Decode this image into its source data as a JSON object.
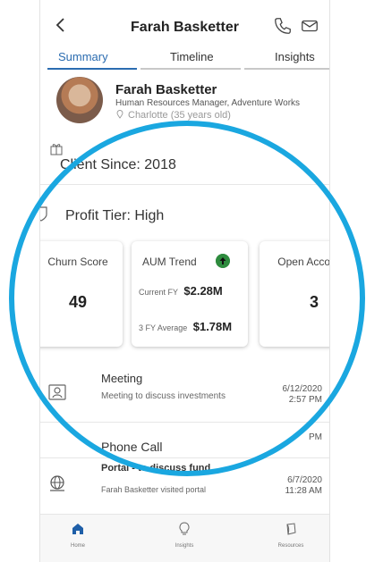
{
  "header": {
    "title": "Farah Basketter"
  },
  "tabs": [
    {
      "label": "Summary",
      "active": true
    },
    {
      "label": "Timeline"
    },
    {
      "label": "Insights"
    }
  ],
  "profile": {
    "name": "Farah Basketter",
    "role": "Human Resources Manager, Adventure Works",
    "details_partial": "Charlotte (35 years old)"
  },
  "summary": {
    "client_since": "Client Since: 2018",
    "profit_tier": "Profit Tier: High"
  },
  "cards": {
    "churn": {
      "title": "Churn Score",
      "value": "49"
    },
    "aum": {
      "title": "AUM Trend",
      "current_label": "Current FY",
      "current_value": "$2.28M",
      "avg_label": "3 FY Average",
      "avg_value": "$1.78M",
      "trend": "up",
      "trend_color": "#2e8b3e"
    },
    "accounts": {
      "title": "Open Accounts",
      "value": "3"
    }
  },
  "timeline": [
    {
      "title": "Meeting",
      "desc": "Meeting to discuss investments",
      "date": "6/12/2020",
      "time": "2:57 PM"
    },
    {
      "title": "Phone Call",
      "date_partial": "PM"
    },
    {
      "title": "Portal - to discuss fund",
      "desc": "Farah Basketter visited portal",
      "date": "6/7/2020",
      "time": "11:28 AM"
    }
  ],
  "nav": [
    {
      "label": "Home",
      "icon": "home-icon",
      "active": true
    },
    {
      "label": "Insights",
      "icon": "lightbulb-icon"
    },
    {
      "label": "Resources",
      "icon": "resources-icon"
    }
  ],
  "colors": {
    "accent": "#2b6cb0",
    "highlight_ring": "#1aa7e0"
  }
}
